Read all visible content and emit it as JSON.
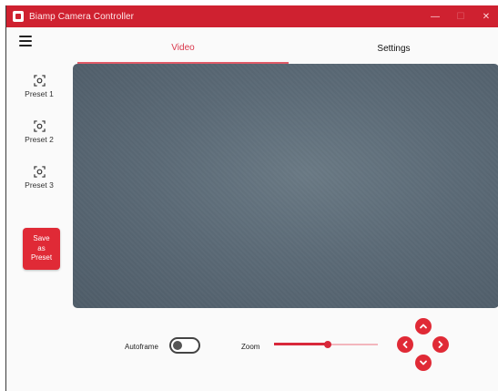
{
  "window": {
    "title": "Biamp Camera Controller",
    "controls": {
      "minimize": "—",
      "maximize": "☐",
      "close": "✕"
    }
  },
  "nav": {
    "menu_icon": "hamburger-menu-icon",
    "tabs": [
      {
        "label": "Video",
        "active": true
      },
      {
        "label": "Settings",
        "active": false
      }
    ]
  },
  "presets": [
    {
      "label": "Preset 1",
      "icon": "camera-focus-icon"
    },
    {
      "label": "Preset 2",
      "icon": "camera-focus-icon"
    },
    {
      "label": "Preset 3",
      "icon": "camera-focus-icon"
    }
  ],
  "save_preset_label": "Save as Preset",
  "controls": {
    "autoframe_label": "Autoframe",
    "autoframe_on": false,
    "zoom_label": "Zoom",
    "zoom_fraction": 0.52
  },
  "ptz": {
    "up_icon": "chevron-up-icon",
    "left_icon": "chevron-left-icon",
    "right_icon": "chevron-right-icon",
    "down_icon": "chevron-down-icon"
  },
  "colors": {
    "accent": "#cf2130",
    "button": "#e02a36",
    "video_bg": "#5c6b77"
  }
}
